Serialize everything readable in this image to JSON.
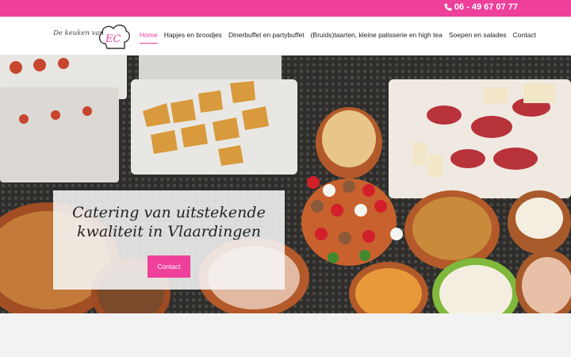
{
  "header": {
    "phone": "06 - 49 67 07 77",
    "phone_icon": "phone-icon"
  },
  "logo": {
    "text": "De keuken van",
    "initials": "EC"
  },
  "nav": {
    "items": [
      {
        "label": "Home",
        "active": true
      },
      {
        "label": "Hapjes en broodjes",
        "active": false
      },
      {
        "label": "Dinerbuffet en partybuffet",
        "active": false
      },
      {
        "label": "(Bruids)taarten, kleine patisserie en high tea",
        "active": false
      },
      {
        "label": "Soepen en salades",
        "active": false
      },
      {
        "label": "Contact",
        "active": false
      }
    ]
  },
  "hero": {
    "title_line1": "Catering van uitstekende",
    "title_line2": "kwaliteit in Vlaardingen",
    "button_label": "Contact"
  },
  "colors": {
    "accent": "#ee3f9a",
    "topbar": "#ee3f9a",
    "card": "#f5f5f5"
  }
}
